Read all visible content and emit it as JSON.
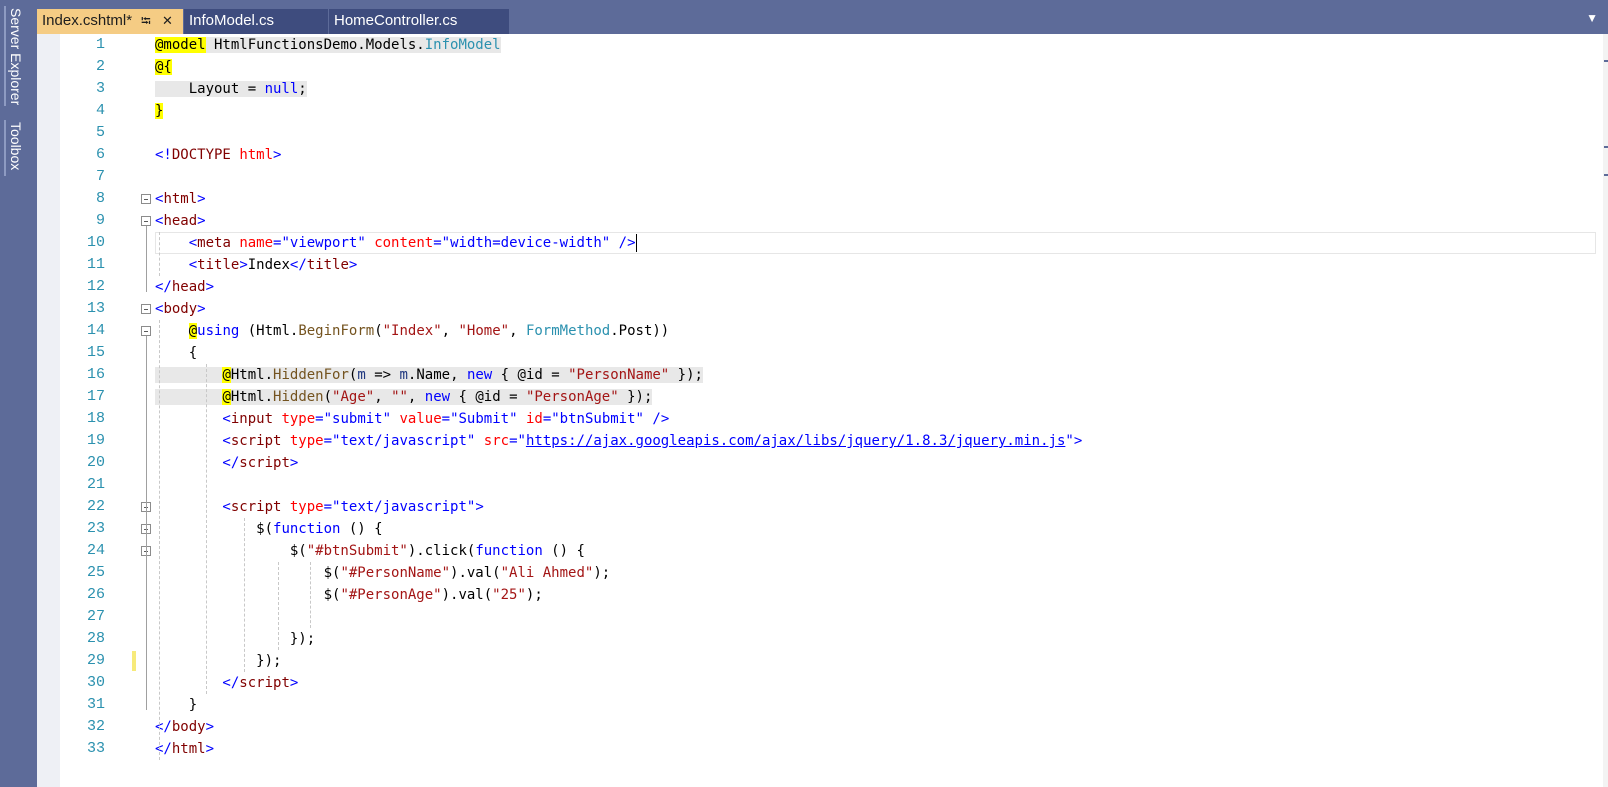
{
  "sidebar": {
    "items": [
      {
        "label": "Server Explorer"
      },
      {
        "label": "Toolbox"
      }
    ]
  },
  "tabs": [
    {
      "label": "Index.cshtml*",
      "active": true,
      "pinned_icon": "pin-icon",
      "close_icon": "close-icon"
    },
    {
      "label": "InfoModel.cs",
      "active": false
    },
    {
      "label": "HomeController.cs",
      "active": false
    }
  ],
  "editor": {
    "line_numbers": [
      "1",
      "2",
      "3",
      "4",
      "5",
      "6",
      "7",
      "8",
      "9",
      "10",
      "11",
      "12",
      "13",
      "14",
      "15",
      "16",
      "17",
      "18",
      "19",
      "20",
      "21",
      "22",
      "23",
      "24",
      "25",
      "26",
      "27",
      "28",
      "29",
      "30",
      "31",
      "32",
      "33"
    ],
    "lines": [
      [
        {
          "t": "@model",
          "c": "rz"
        },
        {
          "t": " HtmlFunctionsDemo.Models.",
          "c": "plain"
        },
        {
          "t": "InfoModel",
          "c": "typ"
        }
      ],
      [
        {
          "t": "@{",
          "c": "rz"
        }
      ],
      [
        {
          "t": "    Layout = ",
          "c": "plain"
        },
        {
          "t": "null",
          "c": "kw"
        },
        {
          "t": ";",
          "c": "plain"
        }
      ],
      [
        {
          "t": "}",
          "c": "rz"
        }
      ],
      [],
      [
        {
          "t": "<!",
          "c": "pun"
        },
        {
          "t": "DOCTYPE",
          "c": "tag"
        },
        {
          "t": " ",
          "c": "plain"
        },
        {
          "t": "html",
          "c": "atr"
        },
        {
          "t": ">",
          "c": "pun"
        }
      ],
      [],
      [
        {
          "t": "<",
          "c": "pun"
        },
        {
          "t": "html",
          "c": "tag"
        },
        {
          "t": ">",
          "c": "pun"
        }
      ],
      [
        {
          "t": "<",
          "c": "pun"
        },
        {
          "t": "head",
          "c": "tag"
        },
        {
          "t": ">",
          "c": "pun"
        }
      ],
      [
        {
          "t": "    <",
          "c": "pun"
        },
        {
          "t": "meta",
          "c": "tag"
        },
        {
          "t": " ",
          "c": "plain"
        },
        {
          "t": "name",
          "c": "atr"
        },
        {
          "t": "=",
          "c": "pun"
        },
        {
          "t": "\"viewport\"",
          "c": "str"
        },
        {
          "t": " ",
          "c": "plain"
        },
        {
          "t": "content",
          "c": "atr"
        },
        {
          "t": "=",
          "c": "pun"
        },
        {
          "t": "\"width=device-width\"",
          "c": "str"
        },
        {
          "t": " />",
          "c": "pun"
        }
      ],
      [
        {
          "t": "    <",
          "c": "pun"
        },
        {
          "t": "title",
          "c": "tag"
        },
        {
          "t": ">",
          "c": "pun"
        },
        {
          "t": "Index",
          "c": "plain"
        },
        {
          "t": "</",
          "c": "pun"
        },
        {
          "t": "title",
          "c": "tag"
        },
        {
          "t": ">",
          "c": "pun"
        }
      ],
      [
        {
          "t": "</",
          "c": "pun"
        },
        {
          "t": "head",
          "c": "tag"
        },
        {
          "t": ">",
          "c": "pun"
        }
      ],
      [
        {
          "t": "<",
          "c": "pun"
        },
        {
          "t": "body",
          "c": "tag"
        },
        {
          "t": ">",
          "c": "pun"
        }
      ],
      [
        {
          "t": "    ",
          "c": "plain"
        },
        {
          "t": "@",
          "c": "rz"
        },
        {
          "t": "using",
          "c": "kw"
        },
        {
          "t": " (Html.",
          "c": "plain"
        },
        {
          "t": "BeginForm",
          "c": "mth"
        },
        {
          "t": "(",
          "c": "plain"
        },
        {
          "t": "\"Index\"",
          "c": "cstr"
        },
        {
          "t": ", ",
          "c": "plain"
        },
        {
          "t": "\"Home\"",
          "c": "cstr"
        },
        {
          "t": ", ",
          "c": "plain"
        },
        {
          "t": "FormMethod",
          "c": "typ"
        },
        {
          "t": ".Post))",
          "c": "plain"
        }
      ],
      [
        {
          "t": "    {",
          "c": "plain"
        }
      ],
      [
        {
          "t": "        ",
          "c": "plain"
        },
        {
          "t": "@",
          "c": "rz"
        },
        {
          "t": "Html.",
          "c": "plain"
        },
        {
          "t": "HiddenFor",
          "c": "mth"
        },
        {
          "t": "(",
          "c": "plain"
        },
        {
          "t": "m",
          "c": "prm"
        },
        {
          "t": " => ",
          "c": "plain"
        },
        {
          "t": "m",
          "c": "prm"
        },
        {
          "t": ".Name, ",
          "c": "plain"
        },
        {
          "t": "new",
          "c": "kw"
        },
        {
          "t": " { @id = ",
          "c": "plain"
        },
        {
          "t": "\"PersonName\"",
          "c": "cstr"
        },
        {
          "t": " });",
          "c": "plain"
        }
      ],
      [
        {
          "t": "        ",
          "c": "plain"
        },
        {
          "t": "@",
          "c": "rz"
        },
        {
          "t": "Html.",
          "c": "plain"
        },
        {
          "t": "Hidden",
          "c": "mth"
        },
        {
          "t": "(",
          "c": "plain"
        },
        {
          "t": "\"Age\"",
          "c": "cstr"
        },
        {
          "t": ", ",
          "c": "plain"
        },
        {
          "t": "\"\"",
          "c": "cstr"
        },
        {
          "t": ", ",
          "c": "plain"
        },
        {
          "t": "new",
          "c": "kw"
        },
        {
          "t": " { @id = ",
          "c": "plain"
        },
        {
          "t": "\"PersonAge\"",
          "c": "cstr"
        },
        {
          "t": " });",
          "c": "plain"
        }
      ],
      [
        {
          "t": "        <",
          "c": "pun"
        },
        {
          "t": "input",
          "c": "tag"
        },
        {
          "t": " ",
          "c": "plain"
        },
        {
          "t": "type",
          "c": "atr"
        },
        {
          "t": "=",
          "c": "pun"
        },
        {
          "t": "\"submit\"",
          "c": "str"
        },
        {
          "t": " ",
          "c": "plain"
        },
        {
          "t": "value",
          "c": "atr"
        },
        {
          "t": "=",
          "c": "pun"
        },
        {
          "t": "\"Submit\"",
          "c": "str"
        },
        {
          "t": " ",
          "c": "plain"
        },
        {
          "t": "id",
          "c": "atr"
        },
        {
          "t": "=",
          "c": "pun"
        },
        {
          "t": "\"btnSubmit\"",
          "c": "str"
        },
        {
          "t": " />",
          "c": "pun"
        }
      ],
      [
        {
          "t": "        <",
          "c": "pun"
        },
        {
          "t": "script",
          "c": "tag"
        },
        {
          "t": " ",
          "c": "plain"
        },
        {
          "t": "type",
          "c": "atr"
        },
        {
          "t": "=",
          "c": "pun"
        },
        {
          "t": "\"text/javascript\"",
          "c": "str"
        },
        {
          "t": " ",
          "c": "plain"
        },
        {
          "t": "src",
          "c": "atr"
        },
        {
          "t": "=",
          "c": "pun"
        },
        {
          "t": "\"",
          "c": "str"
        },
        {
          "t": "https://ajax.googleapis.com/ajax/libs/jquery/1.8.3/jquery.min.js",
          "c": "url"
        },
        {
          "t": "\"",
          "c": "str"
        },
        {
          "t": ">",
          "c": "pun"
        }
      ],
      [
        {
          "t": "        </",
          "c": "pun"
        },
        {
          "t": "script",
          "c": "tag"
        },
        {
          "t": ">",
          "c": "pun"
        }
      ],
      [],
      [
        {
          "t": "        <",
          "c": "pun"
        },
        {
          "t": "script",
          "c": "tag"
        },
        {
          "t": " ",
          "c": "plain"
        },
        {
          "t": "type",
          "c": "atr"
        },
        {
          "t": "=",
          "c": "pun"
        },
        {
          "t": "\"text/javascript\"",
          "c": "str"
        },
        {
          "t": ">",
          "c": "pun"
        }
      ],
      [
        {
          "t": "            $(",
          "c": "plain"
        },
        {
          "t": "function",
          "c": "kw"
        },
        {
          "t": " () {",
          "c": "plain"
        }
      ],
      [
        {
          "t": "                $(",
          "c": "plain"
        },
        {
          "t": "\"#btnSubmit\"",
          "c": "cstr"
        },
        {
          "t": ").click(",
          "c": "plain"
        },
        {
          "t": "function",
          "c": "kw"
        },
        {
          "t": " () {",
          "c": "plain"
        }
      ],
      [
        {
          "t": "                    $(",
          "c": "plain"
        },
        {
          "t": "\"#PersonName\"",
          "c": "cstr"
        },
        {
          "t": ").val(",
          "c": "plain"
        },
        {
          "t": "\"Ali Ahmed\"",
          "c": "cstr"
        },
        {
          "t": ");",
          "c": "plain"
        }
      ],
      [
        {
          "t": "                    $(",
          "c": "plain"
        },
        {
          "t": "\"#PersonAge\"",
          "c": "cstr"
        },
        {
          "t": ").val(",
          "c": "plain"
        },
        {
          "t": "\"25\"",
          "c": "cstr"
        },
        {
          "t": ");",
          "c": "plain"
        }
      ],
      [],
      [
        {
          "t": "                });",
          "c": "plain"
        }
      ],
      [
        {
          "t": "            });",
          "c": "plain"
        }
      ],
      [
        {
          "t": "        </",
          "c": "pun"
        },
        {
          "t": "script",
          "c": "tag"
        },
        {
          "t": ">",
          "c": "pun"
        }
      ],
      [
        {
          "t": "    }",
          "c": "plain"
        }
      ],
      [
        {
          "t": "</",
          "c": "pun"
        },
        {
          "t": "body",
          "c": "tag"
        },
        {
          "t": ">",
          "c": "pun"
        }
      ],
      [
        {
          "t": "</",
          "c": "pun"
        },
        {
          "t": "html",
          "c": "tag"
        },
        {
          "t": ">",
          "c": "pun"
        }
      ]
    ]
  },
  "colors": {
    "frame": "#5d6b99",
    "active_tab": "#f5cc84",
    "inactive_tab": "#3e4c7e",
    "line_number": "#2b91af",
    "razor_highlight": "#ffff00"
  }
}
